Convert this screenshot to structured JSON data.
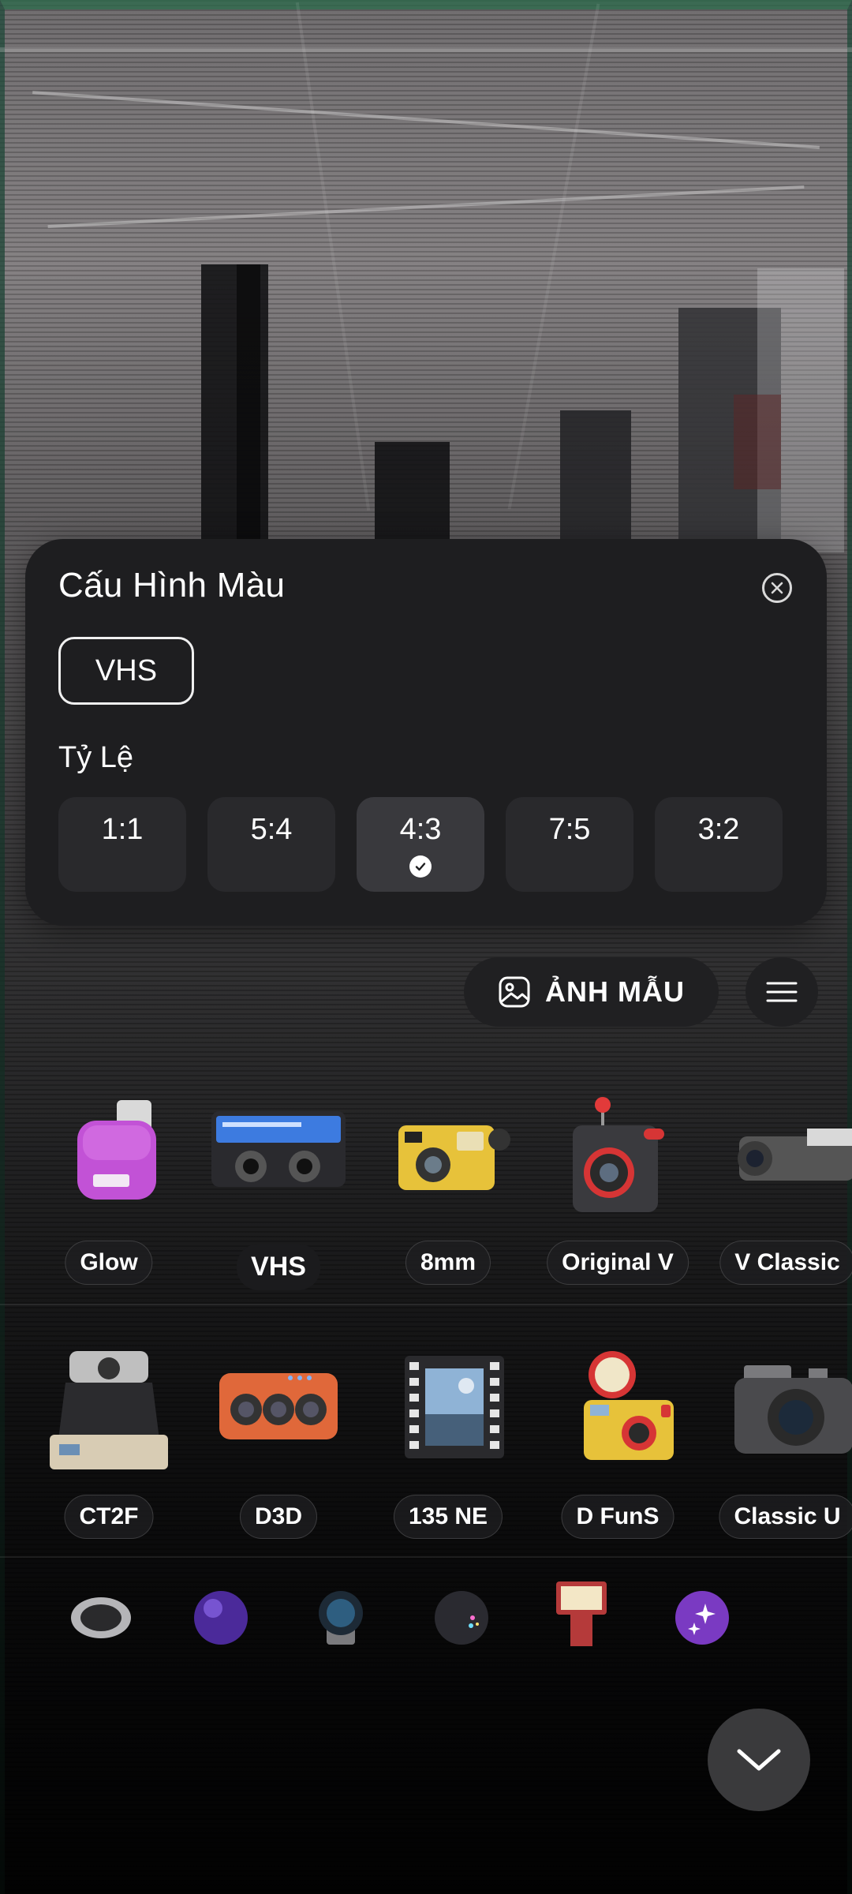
{
  "config_panel": {
    "title": "Cấu Hình Màu",
    "preset": "VHS",
    "ratio_title": "Tỷ Lệ",
    "ratios": [
      "1:1",
      "5:4",
      "4:3",
      "7:5",
      "3:2"
    ],
    "selected_ratio": "4:3"
  },
  "sample_button": {
    "label": "ẢNH MẪU"
  },
  "cameras_row1": [
    "Glow",
    "VHS",
    "8mm",
    "Original V",
    "V Classic"
  ],
  "cameras_row2": [
    "CT2F",
    "D3D",
    "135 NE",
    "D FunS",
    "Classic U"
  ],
  "selected_camera": "VHS",
  "lenses": [
    "oval-lens-icon",
    "purple-sphere-icon",
    "blue-lens-icon",
    "glitter-sphere-icon",
    "flash-icon",
    "sparkle-sphere-icon"
  ],
  "colors": {
    "panel": "#1e1e20",
    "chip": "#29292c",
    "chip_selected": "#39393d"
  }
}
